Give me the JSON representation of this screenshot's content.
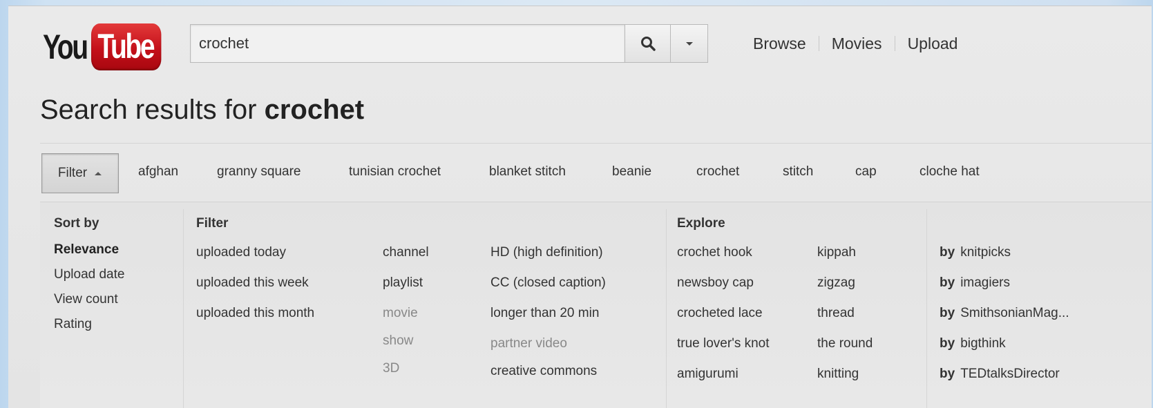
{
  "header": {
    "logo_you": "You",
    "logo_tube": "Tube",
    "search_value": "crochet",
    "nav": [
      "Browse",
      "Movies",
      "Upload"
    ]
  },
  "title": {
    "prefix": "Search results for ",
    "query": "crochet"
  },
  "filter_bar": {
    "filter_label": "Filter",
    "related": [
      "afghan",
      "granny square",
      "tunisian crochet",
      "blanket stitch",
      "beanie",
      "crochet",
      "stitch",
      "cap",
      "cloche hat"
    ]
  },
  "panel": {
    "sort": {
      "heading": "Sort by",
      "items": [
        "Relevance",
        "Upload date",
        "View count",
        "Rating"
      ]
    },
    "filter": {
      "heading": "Filter",
      "upload": [
        "uploaded today",
        "uploaded this week",
        "uploaded this month"
      ],
      "type": [
        "channel",
        "playlist",
        "movie",
        "show",
        "3D"
      ],
      "features": [
        "HD (high definition)",
        "CC (closed caption)",
        "longer than 20 min",
        "partner video",
        "creative commons"
      ]
    },
    "explore": {
      "heading": "Explore",
      "col1": [
        "crochet hook",
        "newsboy cap",
        "crocheted lace",
        "true lover's knot",
        "amigurumi"
      ],
      "col2": [
        "kippah",
        "zigzag",
        "thread",
        "the round",
        "knitting"
      ]
    },
    "channels": {
      "by_label": "by",
      "items": [
        "knitpicks",
        "imagiers",
        "SmithsonianMag...",
        "bigthink",
        "TEDtalksDirector"
      ]
    }
  },
  "colors": {
    "logo_red": "#c4101a",
    "text": "#333333",
    "dim_text": "#888888"
  }
}
